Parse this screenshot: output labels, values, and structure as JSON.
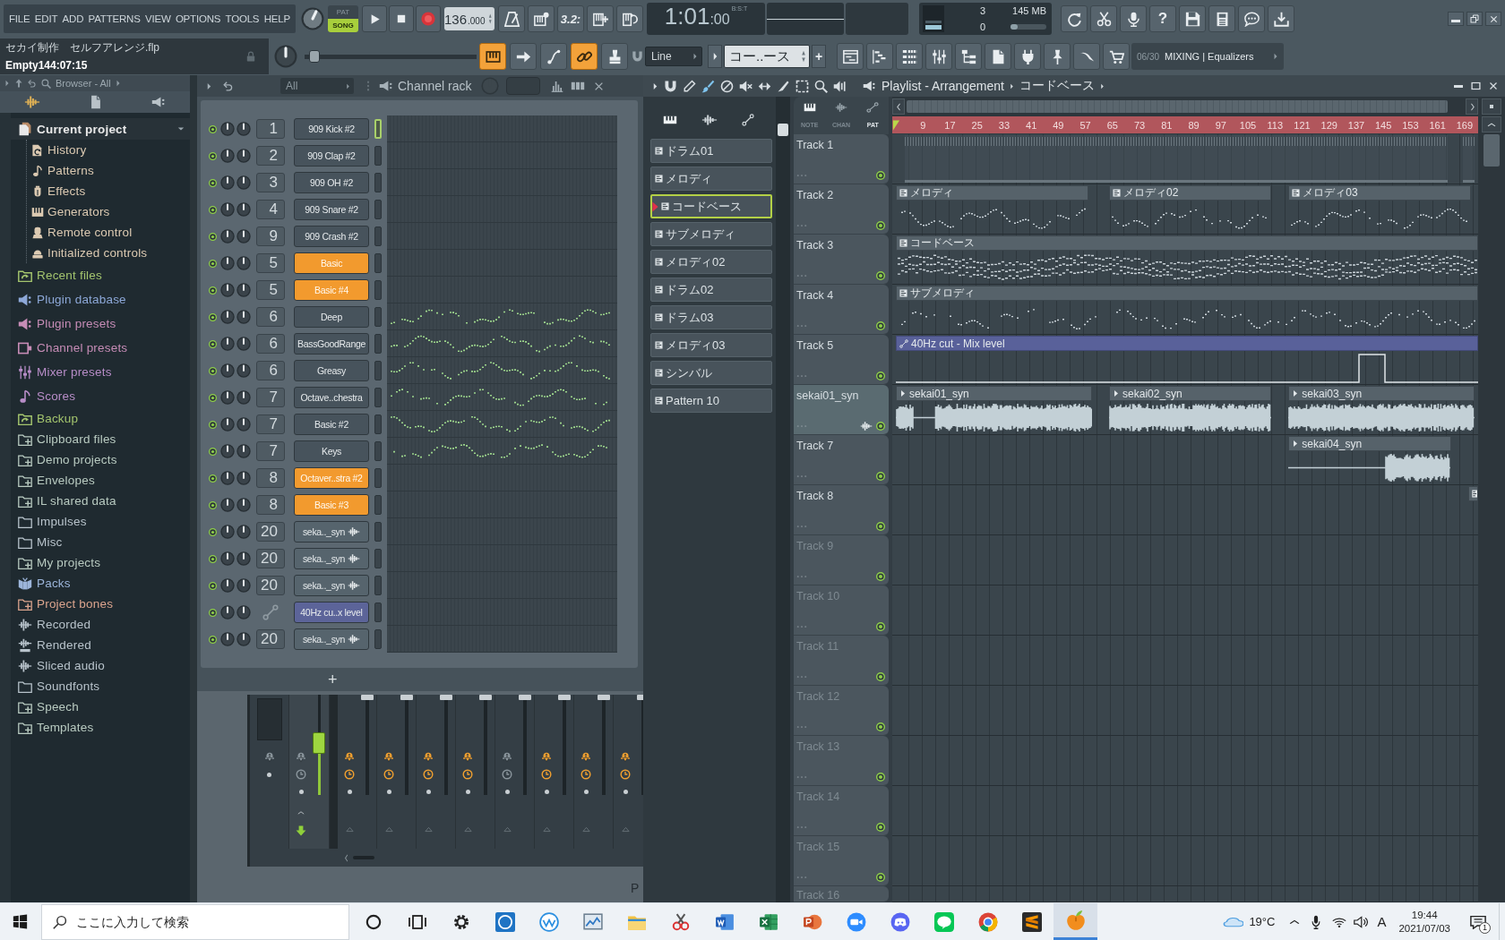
{
  "menu": {
    "items": [
      "FILE",
      "EDIT",
      "ADD",
      "PATTERNS",
      "VIEW",
      "OPTIONS",
      "TOOLS",
      "HELP"
    ]
  },
  "transport": {
    "modes": [
      {
        "label": "PAT",
        "selected": false
      },
      {
        "label": "SONG",
        "selected": true
      }
    ],
    "tempo": "136",
    "tempo_fraction": ".000",
    "countdown": "3.2:",
    "time": "1:01",
    "time_fraction": ":00",
    "time_unit": "B:S:T"
  },
  "monitor": {
    "cpu": "3",
    "memory": "145 MB",
    "polyphony": "0"
  },
  "hint": {
    "title": "セカイ制作　セルフアレンジ.flp",
    "status": "Empty144:07:15"
  },
  "toolbar": {
    "help": "?",
    "slider": {
      "level": 0.03
    },
    "tools": [
      {
        "kind": "typing",
        "on": true
      },
      {
        "kind": "arrow",
        "on": false
      },
      {
        "kind": "step",
        "on": false
      },
      {
        "kind": "link",
        "on": true
      },
      {
        "kind": "stamp",
        "on": false
      }
    ],
    "snap": "Line",
    "pattern": "コー..ース",
    "add_pattern": "+",
    "news_count": "06/30",
    "news": "MIXING | Equalizers"
  },
  "browser": {
    "title": "Browser - All",
    "items": [
      {
        "label": "Current project",
        "kind": "project",
        "color": "#e9e9e9",
        "expanded": true,
        "children": [
          {
            "label": "History",
            "kind": "history",
            "color": "#dccab2"
          },
          {
            "label": "Patterns",
            "kind": "note",
            "color": "#dccab2"
          },
          {
            "label": "Effects",
            "kind": "effect",
            "color": "#dccab2"
          },
          {
            "label": "Generators",
            "kind": "keyboard",
            "color": "#dccab2"
          },
          {
            "label": "Remote control",
            "kind": "remote",
            "color": "#dccab2"
          },
          {
            "label": "Initialized controls",
            "kind": "cup",
            "color": "#dccab2"
          }
        ]
      },
      {
        "label": "Recent files",
        "kind": "recent",
        "color": "#a4c56e",
        "expanded": false
      },
      {
        "label": "Plugin database",
        "kind": "speaker",
        "color": "#8da8d8",
        "expanded": false
      },
      {
        "label": "Plugin presets",
        "kind": "speaker",
        "color": "#c68cb6",
        "expanded": false
      },
      {
        "label": "Channel presets",
        "kind": "channel",
        "color": "#c68cb6",
        "expanded": false
      },
      {
        "label": "Mixer presets",
        "kind": "mixer",
        "color": "#b88dc8",
        "expanded": false
      },
      {
        "label": "Scores",
        "kind": "score",
        "color": "#b88dc8",
        "expanded": false
      },
      {
        "label": "Backup",
        "kind": "backup",
        "color": "#a4c56e",
        "expanded": false
      },
      {
        "label": "Clipboard files",
        "kind": "folderplus",
        "color": "#b9cbc1",
        "expanded": false
      },
      {
        "label": "Demo projects",
        "kind": "folderplus",
        "color": "#b9cbc1",
        "expanded": false
      },
      {
        "label": "Envelopes",
        "kind": "folderplus",
        "color": "#b9cbc1",
        "expanded": false
      },
      {
        "label": "IL shared data",
        "kind": "folderplus",
        "color": "#b9cbc1",
        "expanded": false
      },
      {
        "label": "Impulses",
        "kind": "folder",
        "color": "#b8c3cb",
        "expanded": false
      },
      {
        "label": "Misc",
        "kind": "folder",
        "color": "#b8c3cb",
        "expanded": false
      },
      {
        "label": "My projects",
        "kind": "folderplus",
        "color": "#b9cbc1",
        "expanded": false
      },
      {
        "label": "Packs",
        "kind": "packs",
        "color": "#9cb5da",
        "expanded": false
      },
      {
        "label": "Project bones",
        "kind": "folderplus",
        "color": "#dca58e",
        "expanded": false
      },
      {
        "label": "Recorded",
        "kind": "wave",
        "color": "#b8c3cb",
        "expanded": false
      },
      {
        "label": "Rendered",
        "kind": "render",
        "color": "#b8c3cb",
        "expanded": false
      },
      {
        "label": "Sliced audio",
        "kind": "wave",
        "color": "#b8c3cb",
        "expanded": false
      },
      {
        "label": "Soundfonts",
        "kind": "folder",
        "color": "#b8c3cb",
        "expanded": false
      },
      {
        "label": "Speech",
        "kind": "folderplus",
        "color": "#b9cbc1",
        "expanded": false
      },
      {
        "label": "Templates",
        "kind": "folderplus",
        "color": "#b9cbc1",
        "expanded": false
      }
    ]
  },
  "channel_rack": {
    "filter": "All",
    "title": "Channel rack",
    "add": "+",
    "channels": [
      {
        "number": "1",
        "name": "909 Kick #2",
        "kind": "instrument",
        "color": "#47535c",
        "selected": true,
        "enabled": true,
        "notes": false
      },
      {
        "number": "2",
        "name": "909 Clap #2",
        "kind": "instrument",
        "color": "#47535c",
        "selected": false,
        "enabled": true,
        "notes": false
      },
      {
        "number": "3",
        "name": "909 OH #2",
        "kind": "instrument",
        "color": "#47535c",
        "selected": false,
        "enabled": true,
        "notes": false
      },
      {
        "number": "4",
        "name": "909 Snare #2",
        "kind": "instrument",
        "color": "#47535c",
        "selected": false,
        "enabled": true,
        "notes": false
      },
      {
        "number": "9",
        "name": "909 Crash #2",
        "kind": "instrument",
        "color": "#47535c",
        "selected": false,
        "enabled": true,
        "notes": false
      },
      {
        "number": "5",
        "name": "Basic",
        "kind": "instrument",
        "color": "#f29a2e",
        "selected": false,
        "enabled": true,
        "notes": false
      },
      {
        "number": "5",
        "name": "Basic #4",
        "kind": "instrument",
        "color": "#f29a2e",
        "selected": false,
        "enabled": true,
        "notes": false
      },
      {
        "number": "6",
        "name": "Deep",
        "kind": "instrument",
        "color": "#47535c",
        "selected": false,
        "enabled": true,
        "notes": true
      },
      {
        "number": "6",
        "name": "BassGoodRange",
        "kind": "instrument",
        "color": "#47535c",
        "selected": false,
        "enabled": true,
        "notes": true
      },
      {
        "number": "6",
        "name": "Greasy",
        "kind": "instrument",
        "color": "#47535c",
        "selected": false,
        "enabled": true,
        "notes": true
      },
      {
        "number": "7",
        "name": "Octave..chestra",
        "kind": "instrument",
        "color": "#47535c",
        "selected": false,
        "enabled": true,
        "notes": true
      },
      {
        "number": "7",
        "name": "Basic #2",
        "kind": "instrument",
        "color": "#47535c",
        "selected": false,
        "enabled": true,
        "notes": true
      },
      {
        "number": "7",
        "name": "Keys",
        "kind": "instrument",
        "color": "#47535c",
        "selected": false,
        "enabled": true,
        "notes": true
      },
      {
        "number": "8",
        "name": "Octaver..stra #2",
        "kind": "instrument",
        "color": "#f29a2e",
        "selected": false,
        "enabled": true,
        "notes": false
      },
      {
        "number": "8",
        "name": "Basic #3",
        "kind": "instrument",
        "color": "#f29a2e",
        "selected": false,
        "enabled": true,
        "notes": false
      },
      {
        "number": "20",
        "name": "seka.._syn",
        "kind": "audio",
        "color": "#56646d",
        "selected": false,
        "enabled": true,
        "notes": false
      },
      {
        "number": "20",
        "name": "seka.._syn",
        "kind": "audio",
        "color": "#56646d",
        "selected": false,
        "enabled": true,
        "notes": false
      },
      {
        "number": "20",
        "name": "seka.._syn",
        "kind": "audio",
        "color": "#56646d",
        "selected": false,
        "enabled": true,
        "notes": false
      },
      {
        "name": "40Hz cu..x level",
        "kind": "automation",
        "color": "#5c6499",
        "selected": false,
        "enabled": true,
        "notes": false
      },
      {
        "number": "20",
        "name": "seka.._syn",
        "kind": "audio",
        "color": "#56646d",
        "selected": false,
        "enabled": true,
        "notes": false
      }
    ]
  },
  "mixer": {
    "strips": [
      {
        "kind": "master",
        "selected": false,
        "active": false
      },
      {
        "kind": "insert",
        "selected": true,
        "active": false
      },
      {
        "kind": "insert",
        "selected": false,
        "active": true
      },
      {
        "kind": "insert",
        "selected": false,
        "active": true
      },
      {
        "kind": "insert",
        "selected": false,
        "active": true
      },
      {
        "kind": "insert",
        "selected": false,
        "active": true
      },
      {
        "kind": "insert",
        "selected": false,
        "active": false
      },
      {
        "kind": "insert",
        "selected": false,
        "active": true
      },
      {
        "kind": "insert",
        "selected": false,
        "active": true
      },
      {
        "kind": "insert",
        "selected": false,
        "active": true
      }
    ],
    "text": "P"
  },
  "playlist": {
    "title": "Playlist - Arrangement",
    "current_pattern": "コードベース",
    "patterns": [
      {
        "name": "ドラム01",
        "selected": false
      },
      {
        "name": "メロディ",
        "selected": false
      },
      {
        "name": "コードベース",
        "selected": true
      },
      {
        "name": "サブメロディ",
        "selected": false
      },
      {
        "name": "メロディ02",
        "selected": false
      },
      {
        "name": "ドラム02",
        "selected": false
      },
      {
        "name": "ドラム03",
        "selected": false
      },
      {
        "name": "メロディ03",
        "selected": false
      },
      {
        "name": "シンバル",
        "selected": false
      },
      {
        "name": "Pattern 10",
        "selected": false
      }
    ],
    "picker_modes": [
      {
        "label": "NOTE",
        "selected": false
      },
      {
        "label": "CHAN",
        "selected": false
      },
      {
        "label": "PAT",
        "selected": true
      }
    ],
    "ruler": [
      "9",
      "17",
      "25",
      "33",
      "41",
      "49",
      "57",
      "65",
      "73",
      "81",
      "89",
      "97",
      "105",
      "113",
      "121",
      "129",
      "137",
      "145",
      "153",
      "161",
      "169"
    ],
    "tracks": [
      {
        "name": "Track 1",
        "kind": "default",
        "selected": false,
        "dimmed": false,
        "enabled": true,
        "clips": [
          {
            "kind": "drum"
          },
          {
            "kind": "drum"
          }
        ]
      },
      {
        "name": "Track 2",
        "kind": "default",
        "selected": false,
        "dimmed": false,
        "enabled": true,
        "clips": [
          {
            "kind": "pattern",
            "name": "メロディ"
          },
          {
            "kind": "pattern",
            "name": "メロディ02"
          },
          {
            "kind": "pattern",
            "name": "メロディ03"
          }
        ]
      },
      {
        "name": "Track 3",
        "kind": "default",
        "selected": false,
        "dimmed": false,
        "enabled": true,
        "clips": [
          {
            "kind": "pattern",
            "name": "コードベース"
          }
        ]
      },
      {
        "name": "Track 4",
        "kind": "default",
        "selected": false,
        "dimmed": false,
        "enabled": true,
        "clips": [
          {
            "kind": "pattern",
            "name": "サブメロディ"
          }
        ]
      },
      {
        "name": "Track 5",
        "kind": "default",
        "selected": false,
        "dimmed": false,
        "enabled": true,
        "clips": [
          {
            "kind": "automation",
            "name": "40Hz cut - Mix level"
          }
        ]
      },
      {
        "name": "sekai01_syn",
        "kind": "audio",
        "selected": true,
        "dimmed": false,
        "enabled": true,
        "clips": [
          {
            "kind": "audio",
            "name": "sekai01_syn"
          },
          {
            "kind": "audio",
            "name": "sekai02_syn"
          },
          {
            "kind": "audio",
            "name": "sekai03_syn"
          }
        ]
      },
      {
        "name": "Track 7",
        "kind": "default",
        "selected": false,
        "dimmed": false,
        "enabled": true,
        "clips": [
          {
            "kind": "audio",
            "name": "sekai04_syn"
          }
        ]
      },
      {
        "name": "Track 8",
        "kind": "default",
        "selected": false,
        "dimmed": false,
        "enabled": true,
        "clips": [
          {
            "kind": "pattern"
          }
        ]
      },
      {
        "name": "Track 9",
        "kind": "default",
        "selected": false,
        "dimmed": true,
        "enabled": true
      },
      {
        "name": "Track 10",
        "kind": "default",
        "selected": false,
        "dimmed": true,
        "enabled": true
      },
      {
        "name": "Track 11",
        "kind": "default",
        "selected": false,
        "dimmed": true,
        "enabled": true
      },
      {
        "name": "Track 12",
        "kind": "default",
        "selected": false,
        "dimmed": true,
        "enabled": true
      },
      {
        "name": "Track 13",
        "kind": "default",
        "selected": false,
        "dimmed": true,
        "enabled": true
      },
      {
        "name": "Track 14",
        "kind": "default",
        "selected": false,
        "dimmed": true,
        "enabled": true
      },
      {
        "name": "Track 15",
        "kind": "default",
        "selected": false,
        "dimmed": true,
        "enabled": true
      },
      {
        "name": "Track 16",
        "kind": "default",
        "selected": false,
        "dimmed": true
      }
    ]
  },
  "taskbar": {
    "search_placeholder": "ここに入力して検索",
    "apps": [
      {
        "kind": "assistant",
        "selected": false
      },
      {
        "kind": "taskview",
        "selected": false
      },
      {
        "kind": "settings",
        "selected": false
      },
      {
        "kind": "badge",
        "selected": false
      },
      {
        "kind": "ring",
        "selected": false
      },
      {
        "kind": "chart",
        "selected": false
      },
      {
        "kind": "folder",
        "selected": false
      },
      {
        "kind": "snip",
        "selected": false
      },
      {
        "kind": "doc",
        "selected": false
      },
      {
        "kind": "sheet",
        "selected": false
      },
      {
        "kind": "slides",
        "selected": false
      },
      {
        "kind": "camera",
        "selected": false
      },
      {
        "kind": "pad",
        "selected": false
      },
      {
        "kind": "chat",
        "selected": false
      },
      {
        "kind": "globe",
        "selected": false
      },
      {
        "kind": "stripes",
        "selected": false
      },
      {
        "kind": "fruit",
        "selected": true
      }
    ],
    "temperature": "19°C",
    "ime": "A",
    "time": "19:44",
    "date": "2021/07/03",
    "notifications": "1"
  }
}
